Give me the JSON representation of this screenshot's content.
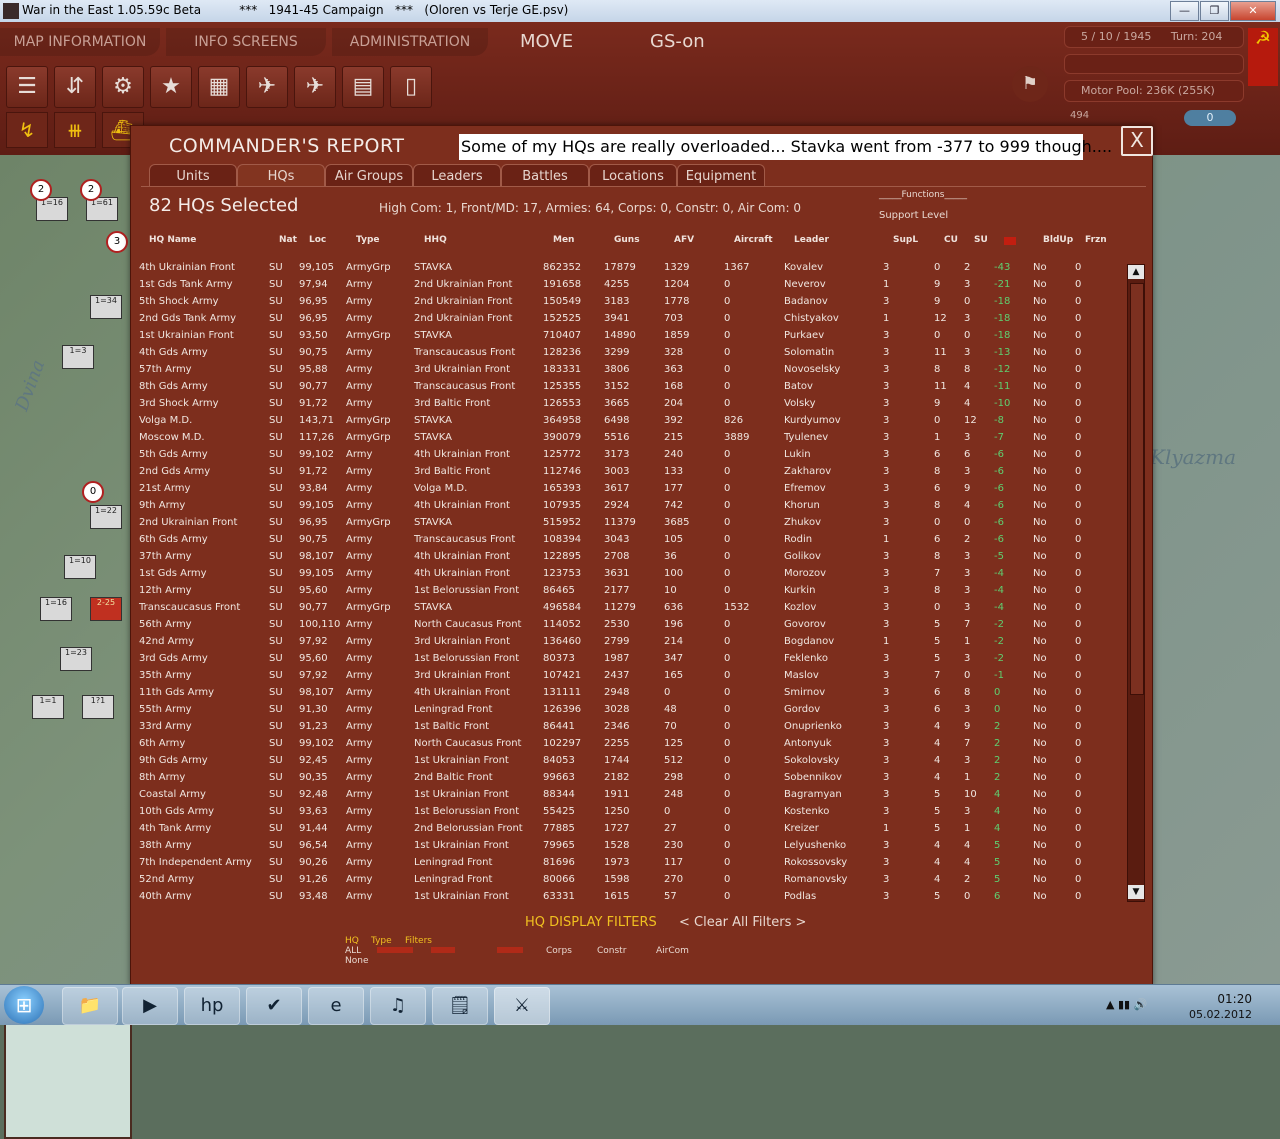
{
  "window": {
    "title": "War in the East 1.05.59c Beta          ***   1941-45 Campaign   ***   (Oloren vs Terje GE.psv)",
    "minimize": "—",
    "maximize": "❐",
    "close": "✕"
  },
  "gamebar": {
    "tabs": [
      "MAP INFORMATION",
      "INFO SCREENS",
      "ADMINISTRATION"
    ],
    "move": "MOVE",
    "gs": "GS-on",
    "date": "5 / 10 / 1945",
    "turn": "Turn: 204",
    "motor_pool": "Motor Pool:  236K (255K)",
    "counter_left": "494",
    "counter_right": "0",
    "tool_icons": [
      "☰",
      "⇵",
      "⚙",
      "★",
      "▦",
      "✈",
      "✈",
      "▤",
      "▯"
    ]
  },
  "map": {
    "labels": [
      "Dvina",
      "Klyazma"
    ]
  },
  "dialog": {
    "title": "COMMANDER'S REPORT",
    "annotation": "Some of my HQs are really overloaded... Stavka went from -377 to 999 though....",
    "close": "X",
    "tabs": [
      "Units",
      "HQs",
      "Air Groups",
      "Leaders",
      "Battles",
      "Locations",
      "Equipment"
    ],
    "active_tab": "HQs",
    "count": "82 HQs Selected",
    "summary": "High Com: 1, Front/MD: 17, Armies: 64, Corps: 0, Constr: 0, Air Com: 0",
    "functions": "_____Functions_____",
    "support_level": "Support Level",
    "columns": [
      "HQ Name",
      "Nat",
      "Loc",
      "Type",
      "HHQ",
      "Men",
      "Guns",
      "AFV",
      "Aircraft",
      "Leader",
      "SupL",
      "CU",
      "SU",
      "",
      "BldUp",
      "Frzn"
    ],
    "rows": [
      [
        "4th Ukrainian Front",
        "SU",
        "99,105",
        "ArmyGrp",
        "STAVKA",
        "862352",
        "17879",
        "1329",
        "1367",
        "Kovalev",
        "3",
        "0",
        "2",
        "-43",
        "No",
        "0"
      ],
      [
        "1st Gds Tank Army",
        "SU",
        "97,94",
        "Army",
        "2nd Ukrainian Front",
        "191658",
        "4255",
        "1204",
        "0",
        "Neverov",
        "1",
        "9",
        "3",
        "-21",
        "No",
        "0"
      ],
      [
        "5th Shock Army",
        "SU",
        "96,95",
        "Army",
        "2nd Ukrainian Front",
        "150549",
        "3183",
        "1778",
        "0",
        "Badanov",
        "3",
        "9",
        "0",
        "-18",
        "No",
        "0"
      ],
      [
        "2nd Gds Tank Army",
        "SU",
        "96,95",
        "Army",
        "2nd Ukrainian Front",
        "152525",
        "3941",
        "703",
        "0",
        "Chistyakov",
        "1",
        "12",
        "3",
        "-18",
        "No",
        "0"
      ],
      [
        "1st Ukrainian Front",
        "SU",
        "93,50",
        "ArmyGrp",
        "STAVKA",
        "710407",
        "14890",
        "1859",
        "0",
        "Purkaev",
        "3",
        "0",
        "0",
        "-18",
        "No",
        "0"
      ],
      [
        "4th Gds Army",
        "SU",
        "90,75",
        "Army",
        "Transcaucasus Front",
        "128236",
        "3299",
        "328",
        "0",
        "Solomatin",
        "3",
        "11",
        "3",
        "-13",
        "No",
        "0"
      ],
      [
        "57th Army",
        "SU",
        "95,88",
        "Army",
        "3rd Ukrainian Front",
        "183331",
        "3806",
        "363",
        "0",
        "Novoselsky",
        "3",
        "8",
        "8",
        "-12",
        "No",
        "0"
      ],
      [
        "8th Gds Army",
        "SU",
        "90,77",
        "Army",
        "Transcaucasus Front",
        "125355",
        "3152",
        "168",
        "0",
        "Batov",
        "3",
        "11",
        "4",
        "-11",
        "No",
        "0"
      ],
      [
        "3rd Shock Army",
        "SU",
        "91,72",
        "Army",
        "3rd Baltic Front",
        "126553",
        "3665",
        "204",
        "0",
        "Volsky",
        "3",
        "9",
        "4",
        "-10",
        "No",
        "0"
      ],
      [
        "Volga M.D.",
        "SU",
        "143,71",
        "ArmyGrp",
        "STAVKA",
        "364958",
        "6498",
        "392",
        "826",
        "Kurdyumov",
        "3",
        "0",
        "12",
        "-8",
        "No",
        "0"
      ],
      [
        "Moscow M.D.",
        "SU",
        "117,26",
        "ArmyGrp",
        "STAVKA",
        "390079",
        "5516",
        "215",
        "3889",
        "Tyulenev",
        "3",
        "1",
        "3",
        "-7",
        "No",
        "0"
      ],
      [
        "5th Gds Army",
        "SU",
        "99,102",
        "Army",
        "4th Ukrainian Front",
        "125772",
        "3173",
        "240",
        "0",
        "Lukin",
        "3",
        "6",
        "6",
        "-6",
        "No",
        "0"
      ],
      [
        "2nd Gds Army",
        "SU",
        "91,72",
        "Army",
        "3rd Baltic Front",
        "112746",
        "3003",
        "133",
        "0",
        "Zakharov",
        "3",
        "8",
        "3",
        "-6",
        "No",
        "0"
      ],
      [
        "21st Army",
        "SU",
        "93,84",
        "Army",
        "Volga M.D.",
        "165393",
        "3617",
        "177",
        "0",
        "Efremov",
        "3",
        "6",
        "9",
        "-6",
        "No",
        "0"
      ],
      [
        "9th Army",
        "SU",
        "99,105",
        "Army",
        "4th Ukrainian Front",
        "107935",
        "2924",
        "742",
        "0",
        "Khorun",
        "3",
        "8",
        "4",
        "-6",
        "No",
        "0"
      ],
      [
        "2nd Ukrainian Front",
        "SU",
        "96,95",
        "ArmyGrp",
        "STAVKA",
        "515952",
        "11379",
        "3685",
        "0",
        "Zhukov",
        "3",
        "0",
        "0",
        "-6",
        "No",
        "0"
      ],
      [
        "6th Gds Army",
        "SU",
        "90,75",
        "Army",
        "Transcaucasus Front",
        "108394",
        "3043",
        "105",
        "0",
        "Rodin",
        "1",
        "6",
        "2",
        "-6",
        "No",
        "0"
      ],
      [
        "37th Army",
        "SU",
        "98,107",
        "Army",
        "4th Ukrainian Front",
        "122895",
        "2708",
        "36",
        "0",
        "Golikov",
        "3",
        "8",
        "3",
        "-5",
        "No",
        "0"
      ],
      [
        "1st Gds Army",
        "SU",
        "99,105",
        "Army",
        "4th Ukrainian Front",
        "123753",
        "3631",
        "100",
        "0",
        "Morozov",
        "3",
        "7",
        "3",
        "-4",
        "No",
        "0"
      ],
      [
        "12th Army",
        "SU",
        "95,60",
        "Army",
        "1st Belorussian Front",
        "86465",
        "2177",
        "10",
        "0",
        "Kurkin",
        "3",
        "8",
        "3",
        "-4",
        "No",
        "0"
      ],
      [
        "Transcaucasus Front",
        "SU",
        "90,77",
        "ArmyGrp",
        "STAVKA",
        "496584",
        "11279",
        "636",
        "1532",
        "Kozlov",
        "3",
        "0",
        "3",
        "-4",
        "No",
        "0"
      ],
      [
        "56th Army",
        "SU",
        "100,110",
        "Army",
        "North Caucasus Front",
        "114052",
        "2530",
        "196",
        "0",
        "Govorov",
        "3",
        "5",
        "7",
        "-2",
        "No",
        "0"
      ],
      [
        "42nd Army",
        "SU",
        "97,92",
        "Army",
        "3rd Ukrainian Front",
        "136460",
        "2799",
        "214",
        "0",
        "Bogdanov",
        "1",
        "5",
        "1",
        "-2",
        "No",
        "0"
      ],
      [
        "3rd Gds Army",
        "SU",
        "95,60",
        "Army",
        "1st Belorussian Front",
        "80373",
        "1987",
        "347",
        "0",
        "Feklenko",
        "3",
        "5",
        "3",
        "-2",
        "No",
        "0"
      ],
      [
        "35th Army",
        "SU",
        "97,92",
        "Army",
        "3rd Ukrainian Front",
        "107421",
        "2437",
        "165",
        "0",
        "Maslov",
        "3",
        "7",
        "0",
        "-1",
        "No",
        "0"
      ],
      [
        "11th Gds Army",
        "SU",
        "98,107",
        "Army",
        "4th Ukrainian Front",
        "131111",
        "2948",
        "0",
        "0",
        "Smirnov",
        "3",
        "6",
        "8",
        "0",
        "No",
        "0"
      ],
      [
        "55th Army",
        "SU",
        "91,30",
        "Army",
        "Leningrad Front",
        "126396",
        "3028",
        "48",
        "0",
        "Gordov",
        "3",
        "6",
        "3",
        "0",
        "No",
        "0"
      ],
      [
        "33rd Army",
        "SU",
        "91,23",
        "Army",
        "1st Baltic Front",
        "86441",
        "2346",
        "70",
        "0",
        "Onuprienko",
        "3",
        "4",
        "9",
        "2",
        "No",
        "0"
      ],
      [
        "6th Army",
        "SU",
        "99,102",
        "Army",
        "North Caucasus Front",
        "102297",
        "2255",
        "125",
        "0",
        "Antonyuk",
        "3",
        "4",
        "7",
        "2",
        "No",
        "0"
      ],
      [
        "9th Gds Army",
        "SU",
        "92,45",
        "Army",
        "1st Ukrainian Front",
        "84053",
        "1744",
        "512",
        "0",
        "Sokolovsky",
        "3",
        "4",
        "3",
        "2",
        "No",
        "0"
      ],
      [
        "8th Army",
        "SU",
        "90,35",
        "Army",
        "2nd Baltic Front",
        "99663",
        "2182",
        "298",
        "0",
        "Sobennikov",
        "3",
        "4",
        "1",
        "2",
        "No",
        "0"
      ],
      [
        "Coastal Army",
        "SU",
        "92,48",
        "Army",
        "1st Ukrainian Front",
        "88344",
        "1911",
        "248",
        "0",
        "Bagramyan",
        "3",
        "5",
        "10",
        "4",
        "No",
        "0"
      ],
      [
        "10th Gds Army",
        "SU",
        "93,63",
        "Army",
        "1st Belorussian Front",
        "55425",
        "1250",
        "0",
        "0",
        "Kostenko",
        "3",
        "5",
        "3",
        "4",
        "No",
        "0"
      ],
      [
        "4th Tank Army",
        "SU",
        "91,44",
        "Army",
        "2nd Belorussian Front",
        "77885",
        "1727",
        "27",
        "0",
        "Kreizer",
        "1",
        "5",
        "1",
        "4",
        "No",
        "0"
      ],
      [
        "38th Army",
        "SU",
        "96,54",
        "Army",
        "1st Ukrainian Front",
        "79965",
        "1528",
        "230",
        "0",
        "Lelyushenko",
        "3",
        "4",
        "4",
        "5",
        "No",
        "0"
      ],
      [
        "7th Independent Army",
        "SU",
        "90,26",
        "Army",
        "Leningrad Front",
        "81696",
        "1973",
        "117",
        "0",
        "Rokossovsky",
        "3",
        "4",
        "4",
        "5",
        "No",
        "0"
      ],
      [
        "52nd Army",
        "SU",
        "91,26",
        "Army",
        "Leningrad Front",
        "80066",
        "1598",
        "270",
        "0",
        "Romanovsky",
        "3",
        "4",
        "2",
        "5",
        "No",
        "0"
      ],
      [
        "40th Army",
        "SU",
        "93,48",
        "Army",
        "1st Ukrainian Front",
        "63331",
        "1615",
        "57",
        "0",
        "Podlas",
        "3",
        "5",
        "0",
        "6",
        "No",
        "0"
      ]
    ],
    "filters": {
      "title": "HQ DISPLAY FILTERS",
      "clear": "< Clear All Filters >",
      "hq": "HQ",
      "type": "Type",
      "filters_word": "Filters",
      "all": "ALL",
      "none": "None",
      "options": [
        "Corps",
        "Constr",
        "AirCom"
      ]
    }
  },
  "taskbar": {
    "start": "⊞",
    "apps": [
      "📁",
      "▶",
      "hp",
      "✔",
      "e",
      "♫",
      "🗒",
      "⚔"
    ],
    "time": "01:20",
    "date": "05.02.2012",
    "tray": "▲  ▮▮  🔊"
  }
}
